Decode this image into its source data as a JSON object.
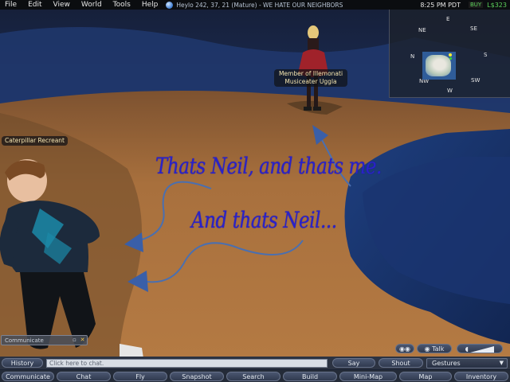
{
  "menu": {
    "items": [
      "File",
      "Edit",
      "View",
      "World",
      "Tools",
      "Help"
    ],
    "location": "Heylo 242, 37, 21 (Mature) - WE HATE OUR NEIGHBORS",
    "clock": "8:25 PM PDT",
    "buy_currency": "BUY",
    "balance": "L$323"
  },
  "minimap": {
    "compass": {
      "n": "N",
      "ne": "NE",
      "e": "E",
      "se": "SE",
      "s": "S",
      "sw": "SW",
      "w": "W",
      "nw": "NW"
    }
  },
  "avatars": {
    "girl_group_line1": "Member of Illemonati",
    "girl_name": "Musiceater Uggla",
    "boy_name": "Caterpillar Recreant"
  },
  "overlay": {
    "line1": "Thats Neil, and thats me.",
    "line2": "And thats Neil..."
  },
  "comm_panel": {
    "label": "Communicate"
  },
  "chat": {
    "history_label": "History",
    "input_placeholder": "Click here to chat.",
    "say_label": "Say",
    "shout_label": "Shout",
    "gestures_label": "Gestures",
    "talk_label": "Talk"
  },
  "toolbar": {
    "buttons": [
      "Communicate",
      "Chat",
      "Fly",
      "Snapshot",
      "Search",
      "Build",
      "Mini-Map",
      "Map",
      "Inventory"
    ]
  },
  "colors": {
    "water": "#1e3a6e",
    "sand": "#a8703d",
    "handwriting": "#2a22c8",
    "balance_green": "#5bd15b"
  }
}
